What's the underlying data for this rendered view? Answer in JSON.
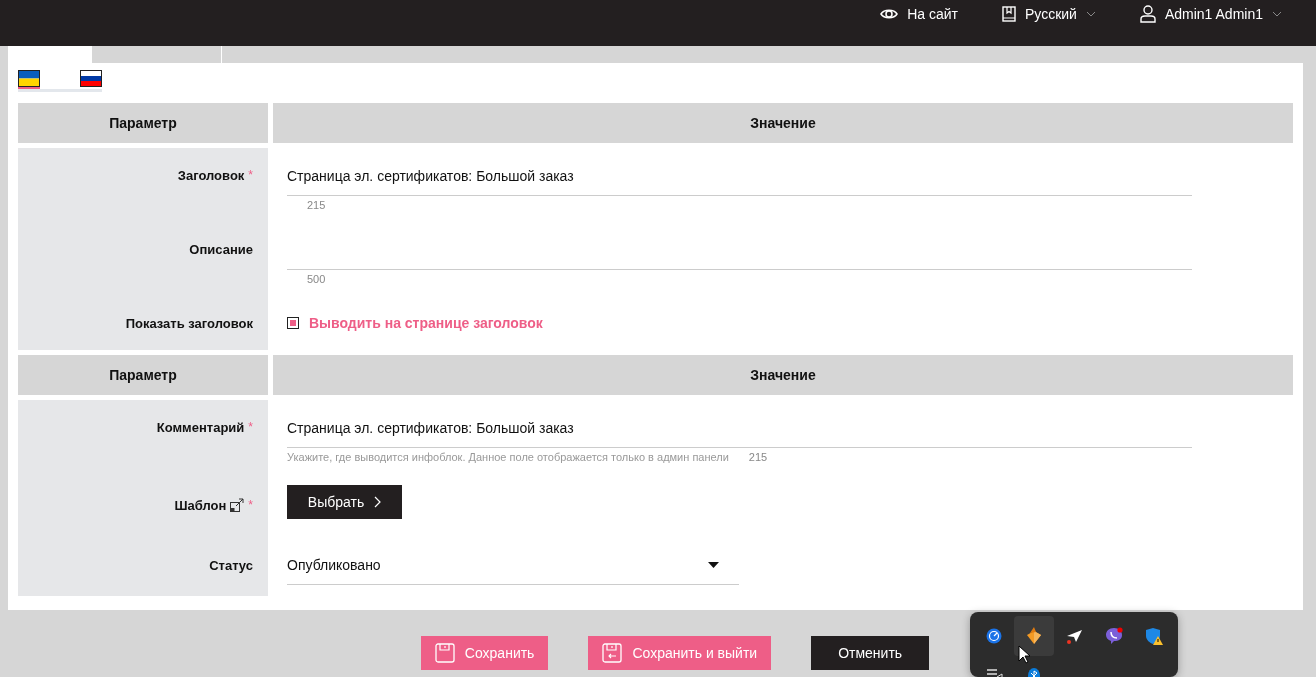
{
  "top_bar": {
    "site_link": "На сайт",
    "language": "Русский",
    "user": "Admin1 Admin1"
  },
  "tabs": [
    {
      "selected": true
    },
    {
      "selected": false
    }
  ],
  "language_flags": [
    {
      "kind": "ukraine",
      "selected": true
    },
    {
      "kind": "russia",
      "selected": false
    }
  ],
  "sections": [
    {
      "columns": [
        "Параметр",
        "Значение"
      ],
      "rows": [
        {
          "kind": "text",
          "label": "Заголовок",
          "required_mark": "*",
          "value": "Страница эл. сертификатов: Большой заказ",
          "counter": "215"
        },
        {
          "kind": "textarea",
          "label": "Описание",
          "counter": "500"
        },
        {
          "kind": "checkbox",
          "label": "Показать заголовок",
          "checked": true,
          "caption": "Выводить на странице заголовок"
        }
      ]
    },
    {
      "columns": [
        "Параметр",
        "Значение"
      ],
      "rows": [
        {
          "kind": "text",
          "label": "Комментарий",
          "required_mark": "*",
          "value": "Страница эл. сертификатов: Большой заказ",
          "hint": "Укажите, где выводится инфоблок. Данное поле отображается только в админ панели",
          "counter": "215"
        },
        {
          "kind": "picker",
          "label": "Шаблон",
          "required_mark": "*",
          "button": "Выбрать"
        },
        {
          "kind": "select",
          "label": "Статус",
          "value": "Опубликовано"
        }
      ]
    }
  ],
  "buttons": [
    {
      "kind": "save",
      "label": "Сохранить"
    },
    {
      "kind": "save_exit",
      "label": "Сохранить и выйти"
    },
    {
      "kind": "cancel",
      "label": "Отменить"
    }
  ]
}
